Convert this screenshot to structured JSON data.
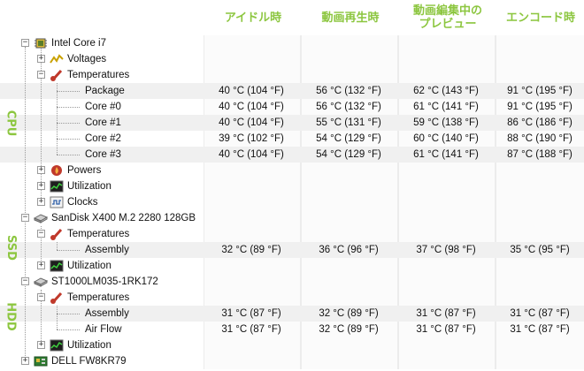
{
  "columns": [
    "アイドル時",
    "動画再生時",
    "動画編集中の\nプレビュー",
    "エンコード時"
  ],
  "sections": {
    "cpu": "CPU",
    "ssd": "SSD",
    "hdd": "HDD"
  },
  "tree": {
    "cpu_name": "Intel Core i7",
    "voltages": "Voltages",
    "temperatures": "Temperatures",
    "package": "Package",
    "core0": "Core #0",
    "core1": "Core #1",
    "core2": "Core #2",
    "core3": "Core #3",
    "powers": "Powers",
    "utilization": "Utilization",
    "clocks": "Clocks",
    "ssd_name": "SanDisk X400 M.2 2280 128GB",
    "ssd_temperatures": "Temperatures",
    "ssd_assembly": "Assembly",
    "ssd_utilization": "Utilization",
    "hdd_name": "ST1000LM035-1RK172",
    "hdd_temperatures": "Temperatures",
    "hdd_assembly": "Assembly",
    "hdd_airflow": "Air Flow",
    "hdd_utilization": "Utilization",
    "mb_name": "DELL FW8KR79"
  },
  "values": {
    "package": [
      "40 °C (104 °F)",
      "56 °C (132 °F)",
      "62 °C (143 °F)",
      "91 °C (195 °F)"
    ],
    "core0": [
      "40 °C (104 °F)",
      "56 °C (132 °F)",
      "61 °C (141 °F)",
      "91 °C (195 °F)"
    ],
    "core1": [
      "40 °C (104 °F)",
      "55 °C (131 °F)",
      "59 °C (138 °F)",
      "86 °C (186 °F)"
    ],
    "core2": [
      "39 °C (102 °F)",
      "54 °C (129 °F)",
      "60 °C (140 °F)",
      "88 °C (190 °F)"
    ],
    "core3": [
      "40 °C (104 °F)",
      "54 °C (129 °F)",
      "61 °C (141 °F)",
      "87 °C (188 °F)"
    ],
    "ssd_assembly": [
      "32 °C (89 °F)",
      "36 °C (96 °F)",
      "37 °C (98 °F)",
      "35 °C (95 °F)"
    ],
    "hdd_assembly": [
      "31 °C (87 °F)",
      "32 °C (89 °F)",
      "31 °C (87 °F)",
      "31 °C (87 °F)"
    ],
    "hdd_airflow": [
      "31 °C (87 °F)",
      "32 °C (89 °F)",
      "31 °C (87 °F)",
      "31 °C (87 °F)"
    ]
  },
  "colors": {
    "accent": "#8cc63f",
    "row_alt": "#f0f0f0"
  },
  "icons": {
    "chip": "chip-icon",
    "voltage": "voltage-icon",
    "thermometer": "thermometer-icon",
    "power": "flame-icon",
    "utilization": "utilization-icon",
    "clock": "clock-icon",
    "drive": "drive-icon",
    "motherboard": "motherboard-icon"
  }
}
